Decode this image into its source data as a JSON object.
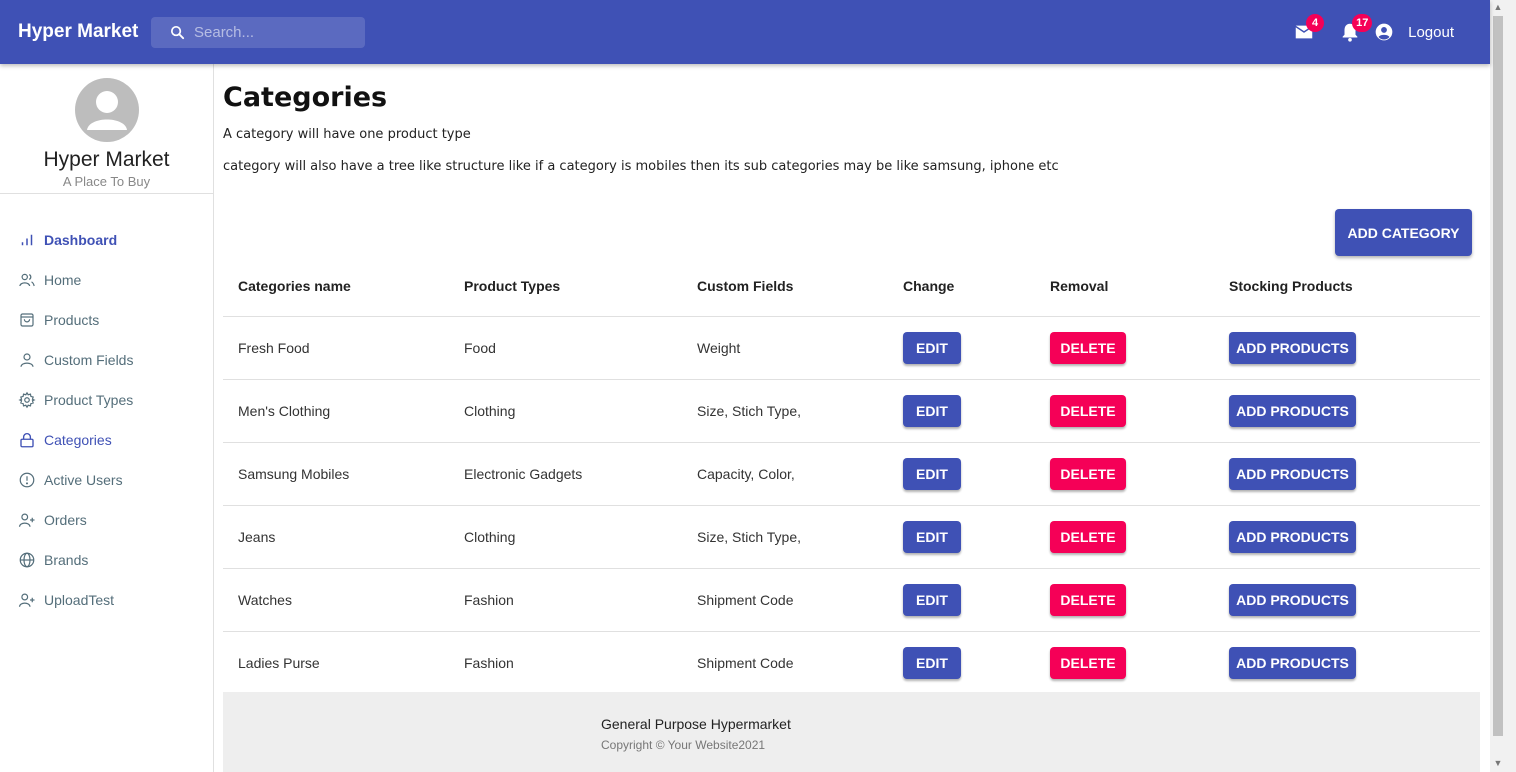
{
  "header": {
    "brand": "Hyper Market",
    "search_placeholder": "Search...",
    "mail_count": "4",
    "notification_count": "17",
    "logout_label": "Logout"
  },
  "sidebar": {
    "profile_name": "Hyper Market",
    "profile_tagline": "A Place To Buy",
    "items": [
      {
        "label": "Dashboard",
        "icon": "bar-chart-icon",
        "active": true
      },
      {
        "label": "Home",
        "icon": "users-icon"
      },
      {
        "label": "Products",
        "icon": "shopping-bag-icon"
      },
      {
        "label": "Custom Fields",
        "icon": "user-icon"
      },
      {
        "label": "Product Types",
        "icon": "gear-icon"
      },
      {
        "label": "Categories",
        "icon": "lock-icon"
      },
      {
        "label": "Active Users",
        "icon": "alert-circle-icon"
      },
      {
        "label": "Orders",
        "icon": "user-plus-icon"
      },
      {
        "label": "Brands",
        "icon": "globe-icon"
      },
      {
        "label": "UploadTest",
        "icon": "user-plus-icon"
      }
    ]
  },
  "main": {
    "title": "Categories",
    "desc1": "A category will have one product type",
    "desc2": "category will also have a tree like structure like if a category is mobiles then its sub categories may be like samsung, iphone etc",
    "add_category_label": "ADD CATEGORY",
    "table": {
      "headers": [
        "Categories name",
        "Product Types",
        "Custom Fields",
        "Change",
        "Removal",
        "Stocking Products"
      ],
      "rows": [
        {
          "name": "Fresh Food",
          "type": "Food",
          "fields": "Weight"
        },
        {
          "name": "Men's Clothing",
          "type": "Clothing",
          "fields": "Size, Stich Type,"
        },
        {
          "name": "Samsung Mobiles",
          "type": "Electronic Gadgets",
          "fields": "Capacity, Color,"
        },
        {
          "name": "Jeans",
          "type": "Clothing",
          "fields": "Size, Stich Type,"
        },
        {
          "name": "Watches",
          "type": "Fashion",
          "fields": "Shipment Code"
        },
        {
          "name": "Ladies Purse",
          "type": "Fashion",
          "fields": "Shipment Code"
        }
      ],
      "edit_label": "EDIT",
      "delete_label": "DELETE",
      "add_products_label": "ADD PRODUCTS"
    }
  },
  "footer": {
    "title": "General Purpose Hypermarket",
    "copyright": "Copyright © Your Website2021"
  },
  "colors": {
    "primary": "#3f51b5",
    "danger": "#f50057"
  }
}
